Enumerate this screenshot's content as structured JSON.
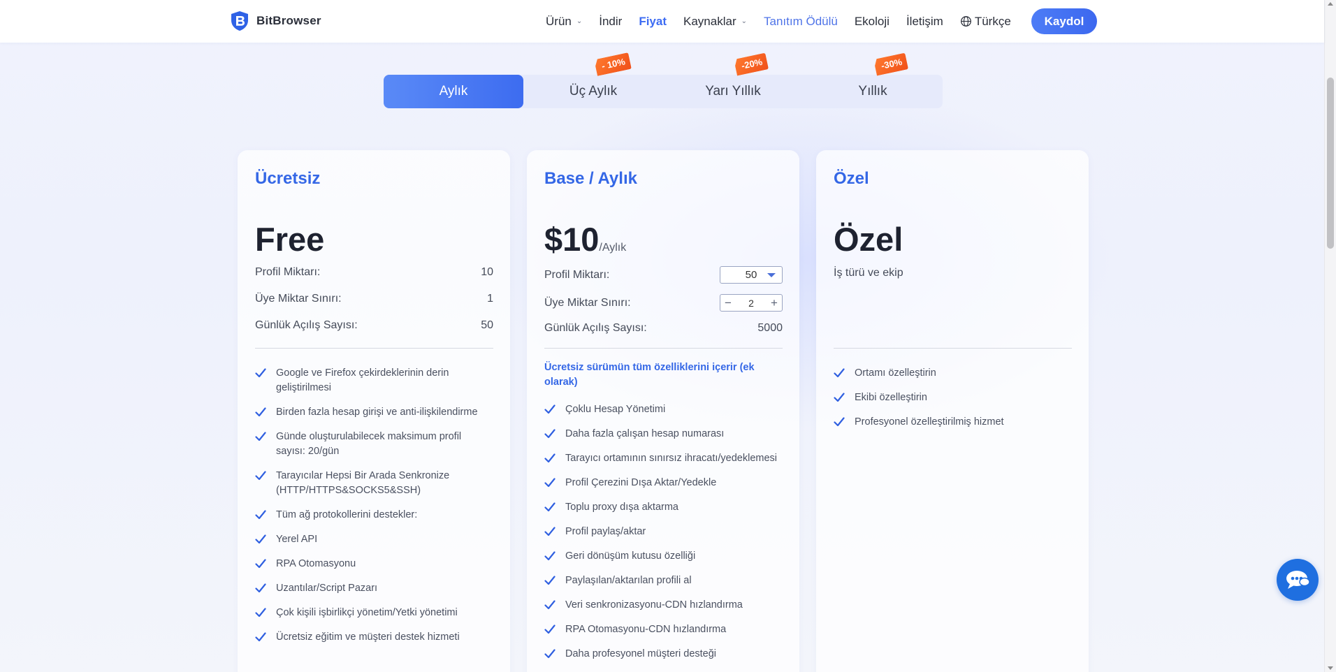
{
  "header": {
    "logo_text": "BitBrowser",
    "nav": [
      {
        "label": "Ürün",
        "has_dropdown": true
      },
      {
        "label": "İndir"
      },
      {
        "label": "Fiyat",
        "active": true
      },
      {
        "label": "Kaynaklar",
        "has_dropdown": true
      },
      {
        "label": "Tanıtım Ödülü"
      },
      {
        "label": "Ekoloji"
      },
      {
        "label": "İletişim"
      },
      {
        "label": "Türkçe"
      }
    ],
    "signup_label": "Kaydol"
  },
  "periods": {
    "tabs": [
      {
        "label": "Aylık",
        "active": true
      },
      {
        "label": "Üç Aylık",
        "badge": "- 10%"
      },
      {
        "label": "Yarı Yıllık",
        "badge": "-20%"
      },
      {
        "label": "Yıllık",
        "badge": "-30%"
      }
    ]
  },
  "plans": {
    "free": {
      "title": "Ücretsiz",
      "price": "Free",
      "rows": [
        {
          "label": "Profil Miktarı:",
          "value": "10"
        },
        {
          "label": "Üye Miktar Sınırı:",
          "value": "1"
        },
        {
          "label": "Günlük Açılış Sayısı:",
          "value": "50"
        }
      ],
      "features": [
        "Google ve Firefox çekirdeklerinin derin geliştirilmesi",
        "Birden fazla hesap girişi ve anti-ilişkilendirme",
        "Günde oluşturulabilecek maksimum profil sayısı: 20/gün",
        "Tarayıcılar Hepsi Bir Arada Senkronize (HTTP/HTTPS&SOCKS5&SSH)",
        "Tüm ağ protokollerini destekler:",
        "Yerel API",
        "RPA Otomasyonu",
        "Uzantılar/Script Pazarı",
        "Çok kişili işbirlikçi yönetim/Yetki yönetimi",
        "Ücretsiz eğitim ve müşteri destek hizmeti"
      ]
    },
    "base": {
      "title": "Base / Aylık",
      "price": "$10",
      "price_unit": "/Aylık",
      "profile_label": "Profil Miktarı:",
      "profile_selected": "50",
      "member_label": "Üye Miktar Sınırı:",
      "member_value": "2",
      "minus": "−",
      "plus": "+",
      "daily_label": "Günlük Açılış Sayısı:",
      "daily_value": "5000",
      "includes_note": "Ücretsiz sürümün tüm özelliklerini içerir (ek olarak)",
      "features": [
        "Çoklu Hesap Yönetimi",
        "Daha fazla çalışan hesap numarası",
        "Tarayıcı ortamının sınırsız ihracatı/yedeklemesi",
        "Profil Çerezini Dışa Aktar/Yedekle",
        "Toplu proxy dışa aktarma",
        "Profil paylaş/aktar",
        "Geri dönüşüm kutusu özelliği",
        "Paylaşılan/aktarılan profili al",
        "Veri senkronizasyonu-CDN hızlandırma",
        "RPA Otomasyonu-CDN hızlandırma",
        "Daha profesyonel müşteri desteği"
      ]
    },
    "custom": {
      "title": "Özel",
      "price": "Özel",
      "subtitle": "İş türü ve ekip",
      "features": [
        "Ortamı özelleştirin",
        "Ekibi özelleştirin",
        "Profesyonel özelleştirilmiş hizmet"
      ]
    }
  },
  "colors": {
    "accent": "#3d6cf3",
    "badge": "#f0501a",
    "chat": "#1f6fe0"
  }
}
